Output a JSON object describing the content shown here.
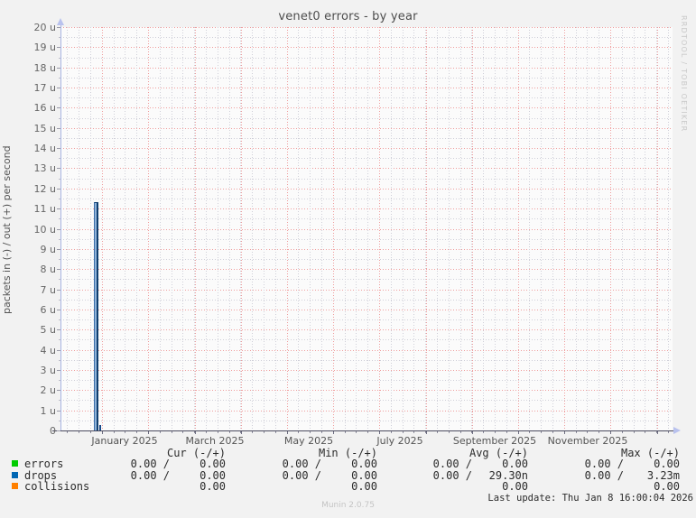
{
  "title": "venet0 errors - by year",
  "watermark": "RRDTOOL / TOBI OETIKER",
  "footer": "Munin 2.0.75",
  "last_update": "Last update: Thu Jan  8 16:00:04 2026",
  "y_axis": {
    "label": "packets in (-) / out (+) per second",
    "ticks": [
      "20 u",
      "19 u",
      "18 u",
      "17 u",
      "16 u",
      "15 u",
      "14 u",
      "13 u",
      "12 u",
      "11 u",
      "10 u",
      "9 u",
      "8 u",
      "7 u",
      "6 u",
      "5 u",
      "4 u",
      "3 u",
      "2 u",
      "1 u",
      "0"
    ]
  },
  "x_axis": {
    "ticks": [
      "January 2025",
      "March 2025",
      "May 2025",
      "July 2025",
      "September 2025",
      "November 2025"
    ]
  },
  "legend": {
    "headers": [
      "Cur (-/+)",
      "Min (-/+)",
      "Avg (-/+)",
      "Max (-/+)"
    ],
    "rows": [
      {
        "label": "errors",
        "color": "#00CC00",
        "values": [
          "0.00 /",
          "0.00",
          "0.00 /",
          "0.00",
          "0.00 /",
          "0.00",
          "0.00 /",
          "0.00"
        ]
      },
      {
        "label": "drops",
        "color": "#0066B3",
        "values": [
          "0.00 /",
          "0.00",
          "0.00 /",
          "0.00",
          "0.00 /",
          "29.30n",
          "0.00 /",
          "3.23m"
        ]
      },
      {
        "label": "collisions",
        "color": "#FF8000",
        "values": [
          "",
          "0.00",
          "",
          "0.00",
          "",
          "0.00",
          "",
          "0.00"
        ]
      }
    ]
  },
  "colors": {
    "grid_major": "#ef9d9d",
    "grid_minor": "#cfcfd8",
    "spike_fill": "#8fb2d9",
    "spike_border": "#0f3e6e",
    "axis_x": "#49495e",
    "axis_y": "#a9b4e2",
    "arrow": "#b9c2ee"
  },
  "chart_data": {
    "type": "area",
    "title": "venet0 errors - by year",
    "xlabel": "",
    "ylabel": "packets in (-) / out (+) per second",
    "ylim": [
      0,
      2e-05
    ],
    "y_tick_step": 1e-06,
    "x_range": [
      "2024-12",
      "2026-01"
    ],
    "x_tick_labels": [
      "January 2025",
      "March 2025",
      "May 2025",
      "July 2025",
      "September 2025",
      "November 2025"
    ],
    "grid": true,
    "legend_position": "bottom",
    "series": [
      {
        "name": "errors",
        "color": "#00CC00",
        "points": [],
        "note": "flat at 0 for the whole year"
      },
      {
        "name": "drops",
        "color": "#0066B3",
        "points": [
          {
            "x": "2025-01-01",
            "y": 1.13e-05
          }
        ],
        "note": "single narrow spike to ~11.3u just before the January 2025 month line; 0 elsewhere; tiny secondary blip at base"
      },
      {
        "name": "collisions",
        "color": "#FF8000",
        "points": [],
        "note": "flat at 0 for the whole year"
      }
    ],
    "summary_table": {
      "columns": [
        "Cur (-/+)",
        "Min (-/+)",
        "Avg (-/+)",
        "Max (-/+)"
      ],
      "rows": [
        {
          "name": "errors",
          "cur": "0.00 / 0.00",
          "min": "0.00 / 0.00",
          "avg": "0.00 / 0.00",
          "max": "0.00 / 0.00"
        },
        {
          "name": "drops",
          "cur": "0.00 / 0.00",
          "min": "0.00 / 0.00",
          "avg": "0.00 / 29.30n",
          "max": "0.00 / 3.23m"
        },
        {
          "name": "collisions",
          "cur": "0.00",
          "min": "0.00",
          "avg": "0.00",
          "max": "0.00"
        }
      ]
    }
  }
}
